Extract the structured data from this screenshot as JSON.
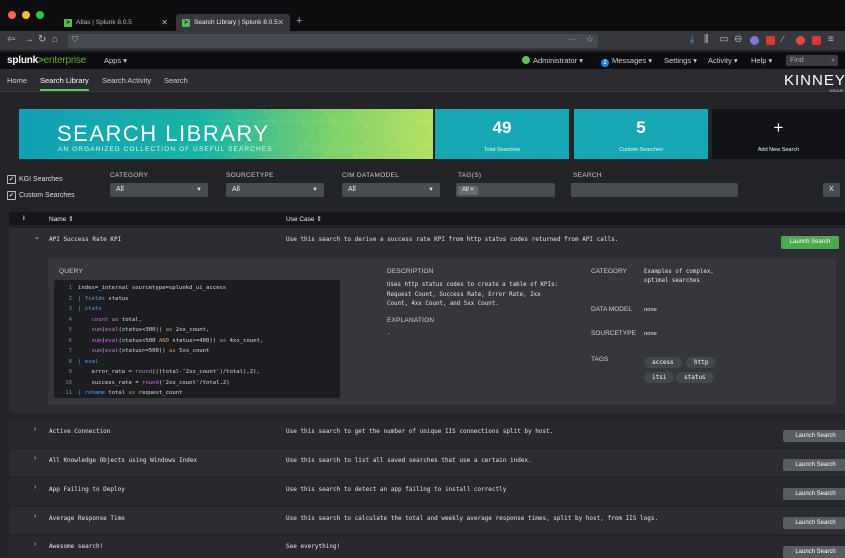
{
  "browser": {
    "tabs": [
      {
        "title": "Atlas | Splunk 8.0.5"
      },
      {
        "title": "Search Library | Splunk 8.0.5"
      }
    ]
  },
  "splunkbar": {
    "logo_main": "splunk",
    "logo_sep": ">",
    "logo_suffix": "enterprise",
    "apps": "Apps ▾",
    "admin": "Administrator ▾",
    "messages_count": "2",
    "messages": "Messages ▾",
    "settings": "Settings ▾",
    "activity": "Activity ▾",
    "help": "Help ▾",
    "find": "Find"
  },
  "appnav": {
    "items": [
      "Home",
      "Search Library",
      "Search Activity",
      "Search"
    ],
    "brand": "KINNEY",
    "brand_sub": "GROUP"
  },
  "hero": {
    "title": "SEARCH LIBRARY",
    "subtitle": "AN ORGANIZED COLLECTION OF USEFUL SEARCHES",
    "total_num": "49",
    "total_label": "Total Searches",
    "custom_num": "5",
    "custom_label": "Custom Searches",
    "add_icon": "+",
    "add_label": "Add New Search"
  },
  "filters": {
    "kgi": "KGI Searches",
    "custom": "Custom Searches",
    "category_label": "CATEGORY",
    "sourcetype_label": "SOURCETYPE",
    "cim_label": "CIM DATAMODEL",
    "tags_label": "TAG(S)",
    "search_label": "SEARCH",
    "all": "All",
    "tag_all": "All ×",
    "clear": "X"
  },
  "table": {
    "col_info": "i",
    "col_name": "Name ⇕",
    "col_usecase": "Use Case ⇕",
    "expanded": {
      "name": "API Success Rate KPI",
      "usecase": "Use this search to derive a success rate KPI from http status codes returned from API calls.",
      "launch": "Launch Search",
      "query_label": "QUERY",
      "description_label": "DESCRIPTION",
      "description": [
        "Uses http status codes to create a table of KPIs:",
        "Request Count, Success Rate, Error Rate, 2xx",
        "Count, 4xx Count, and 5xx Count."
      ],
      "explanation_label": "EXPLANATION",
      "explanation": "-",
      "category_label": "CATEGORY",
      "category": [
        "Examples of complex,",
        "optimal searches"
      ],
      "datamodel_label": "DATA MODEL",
      "datamodel": "none",
      "sourcetype_label": "SOURCETYPE",
      "sourcetype": "none",
      "tags_label": "TAGS",
      "tags": [
        "access",
        "http",
        "itsi",
        "status"
      ]
    },
    "rows": [
      {
        "name": "Active Connection",
        "usecase": "Use this search to get the number of unique IIS connections split by host.",
        "launch": "Launch Search"
      },
      {
        "name": "All Knowledge Objects using Windows Index",
        "usecase": "Use this search to list all saved searches that use a certain index.",
        "launch": "Launch Search"
      },
      {
        "name": "App Failing to Deploy",
        "usecase": "Use this search to detect an app failing to install correctly",
        "launch": "Launch Search"
      },
      {
        "name": "Average Response Time",
        "usecase": "Use this search to calculate the total and weekly average response times, split by host, from IIS logs.",
        "launch": "Launch Search"
      },
      {
        "name": "Awesome search!",
        "usecase": "See everything!",
        "launch": "Launch Search"
      }
    ]
  }
}
